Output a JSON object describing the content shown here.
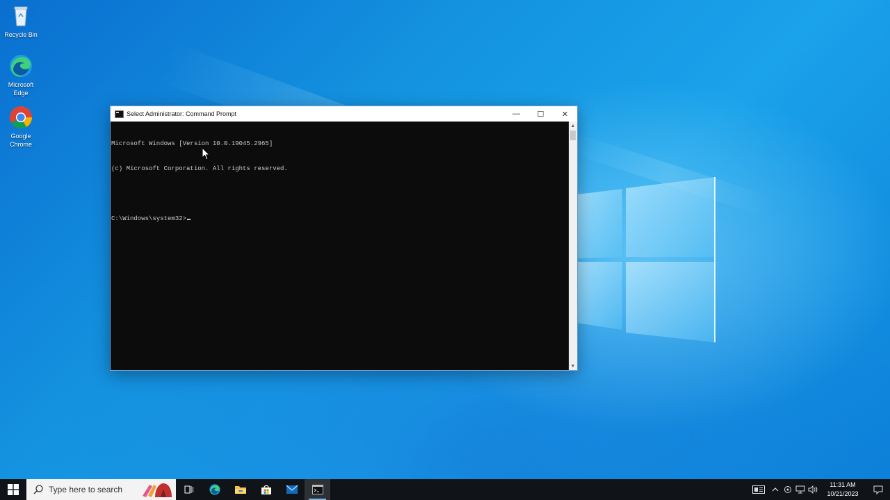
{
  "desktop": {
    "icons": [
      {
        "label": "Recycle Bin",
        "icon": "recycle-bin-icon"
      },
      {
        "label": "Microsoft Edge",
        "icon": "edge-icon"
      },
      {
        "label": "Google Chrome",
        "icon": "chrome-icon"
      }
    ]
  },
  "cmd": {
    "title": "Select Administrator: Command Prompt",
    "lines": [
      "Microsoft Windows [Version 10.0.19045.2965]",
      "(c) Microsoft Corporation. All rights reserved.",
      "",
      "C:\\Windows\\system32>"
    ],
    "buttons": {
      "minimize": "—",
      "maximize": "☐",
      "close": "✕"
    }
  },
  "taskbar": {
    "search_placeholder": "Type here to search",
    "apps": [
      "task-view-icon",
      "edge-icon",
      "file-explorer-icon",
      "store-icon",
      "mail-icon",
      "command-prompt-icon"
    ],
    "clock": {
      "time": "11:31 AM",
      "date": "10/21/2023"
    }
  },
  "colors": {
    "accent": "#0078d7",
    "console_bg": "#0c0c0c",
    "console_fg": "#cccccc",
    "taskbar_bg": "#101418"
  }
}
